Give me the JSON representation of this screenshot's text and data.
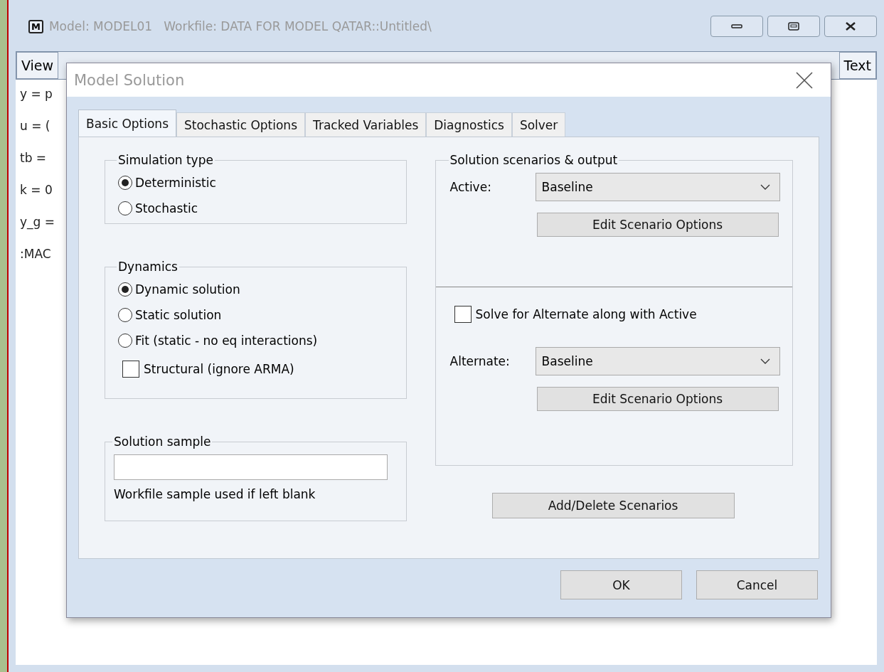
{
  "window": {
    "badge": "M",
    "title": "Model: MODEL01   Workfile: DATA FOR MODEL QATAR::Untitled\\"
  },
  "toolbar": [
    {
      "label": "View"
    },
    {
      "label": "Text"
    }
  ],
  "lines": [
    "y  = p",
    "u  = (",
    "tb  =",
    "k  = 0",
    "y_g  =",
    ":MAC"
  ],
  "dialog": {
    "title": "Model Solution",
    "tabs": [
      {
        "label": "Basic Options",
        "selected": true
      },
      {
        "label": "Stochastic Options",
        "selected": false
      },
      {
        "label": "Tracked Variables",
        "selected": false
      },
      {
        "label": "Diagnostics",
        "selected": false
      },
      {
        "label": "Solver",
        "selected": false
      }
    ],
    "simulation_type": {
      "title": "Simulation type",
      "options": [
        {
          "label": "Deterministic",
          "selected": true
        },
        {
          "label": "Stochastic",
          "selected": false
        }
      ]
    },
    "dynamics": {
      "title": "Dynamics",
      "options": [
        {
          "label": "Dynamic solution",
          "selected": true
        },
        {
          "label": "Static solution",
          "selected": false
        },
        {
          "label": "Fit (static - no eq interactions)",
          "selected": false
        }
      ],
      "structural": {
        "label": "Structural (ignore ARMA)",
        "checked": false
      }
    },
    "solution_sample": {
      "title": "Solution sample",
      "note": "Workfile sample used if left blank"
    },
    "scenarios": {
      "title": "Solution scenarios & output",
      "active_label": "Active:",
      "active_value": "Baseline",
      "edit_button": "Edit Scenario Options",
      "solve_alternate": {
        "label": "Solve for Alternate along with Active",
        "checked": false
      },
      "alternate_label": "Alternate:",
      "alternate_value": "Baseline",
      "edit_button_2": "Edit Scenario Options"
    },
    "add_delete_button": "Add/Delete Scenarios",
    "buttons": [
      "OK",
      "Cancel"
    ]
  }
}
